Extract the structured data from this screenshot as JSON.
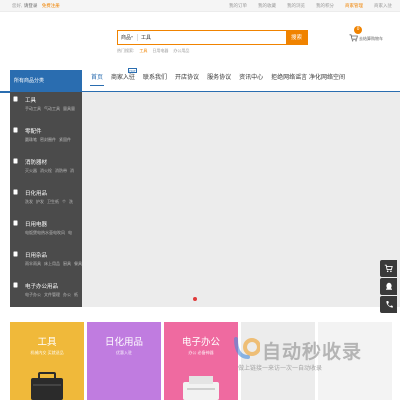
{
  "topbar": {
    "greeting": "您好,",
    "login": "请登录",
    "register": "免费注册",
    "links": [
      "我的订单",
      "我的收藏",
      "我的浏览",
      "我的积分",
      "商家管理",
      "商家入驻"
    ],
    "highlight_index": 4
  },
  "search": {
    "scope": "商品",
    "scope_arrow": "▾",
    "value": "工具",
    "button": "搜索",
    "hot_label": "热门搜索:",
    "hot_words": [
      "工具",
      "日用电器",
      "办公用品"
    ],
    "hot_active_index": 0
  },
  "cart": {
    "count": "0",
    "label": "去结算购物车"
  },
  "nav": {
    "all_categories": "所有商品分类",
    "items": [
      "首页",
      "商家入驻",
      "联系我们",
      "开店协议",
      "服务协议",
      "资讯中心",
      "拒绝网络谣言 净化网络空间"
    ],
    "current_index": 0,
    "hot_badge": "HOT"
  },
  "sidebar": {
    "categories": [
      {
        "title": "工具",
        "subs": [
          "手动工具",
          "气动工具",
          "量具量"
        ],
        "icon": "tool-icon"
      },
      {
        "title": "零配件",
        "subs": [
          "圆珠笔",
          "密封圈件",
          "紧固件"
        ],
        "icon": "parts-icon"
      },
      {
        "title": "消防器材",
        "subs": [
          "灭火器",
          "消火栓",
          "消防带",
          "消"
        ],
        "icon": "fire-icon"
      },
      {
        "title": "日化用品",
        "subs": [
          "洗发",
          "护发",
          "卫生纸",
          "个",
          "洗"
        ],
        "icon": "daily-icon"
      },
      {
        "title": "日用电器",
        "subs": [
          "电饭煲电热水壶电吹风",
          "电"
        ],
        "icon": "appliance-icon"
      },
      {
        "title": "日用杂品",
        "subs": [
          "雨伞雨具",
          "床上用品",
          "厨具",
          "餐具"
        ],
        "icon": "goods-icon"
      },
      {
        "title": "电子办公用品",
        "subs": [
          "电子办公",
          "文件管理",
          "办公",
          "纸"
        ],
        "icon": "office-icon"
      }
    ]
  },
  "tiles": [
    {
      "title": "工具",
      "sub": "机械内交 买就送品",
      "color": "#f0b93a"
    },
    {
      "title": "日化用品",
      "sub": "优惠入驻",
      "color": "#c07ce0"
    },
    {
      "title": "电子办公",
      "sub": "办公 必备神器",
      "color": "#ef6aa0"
    },
    {
      "title": "",
      "sub": "",
      "color": "#ececec"
    },
    {
      "title": "",
      "sub": "",
      "color": "#f3f3f3"
    }
  ],
  "watermark": {
    "title": "自动秒收录",
    "sub": "做上链接一来访一次一自动收录"
  },
  "colors": {
    "accent": "#f08300",
    "nav_blue": "#2a6db0",
    "sidebar_bg": "#4b4b4b"
  }
}
